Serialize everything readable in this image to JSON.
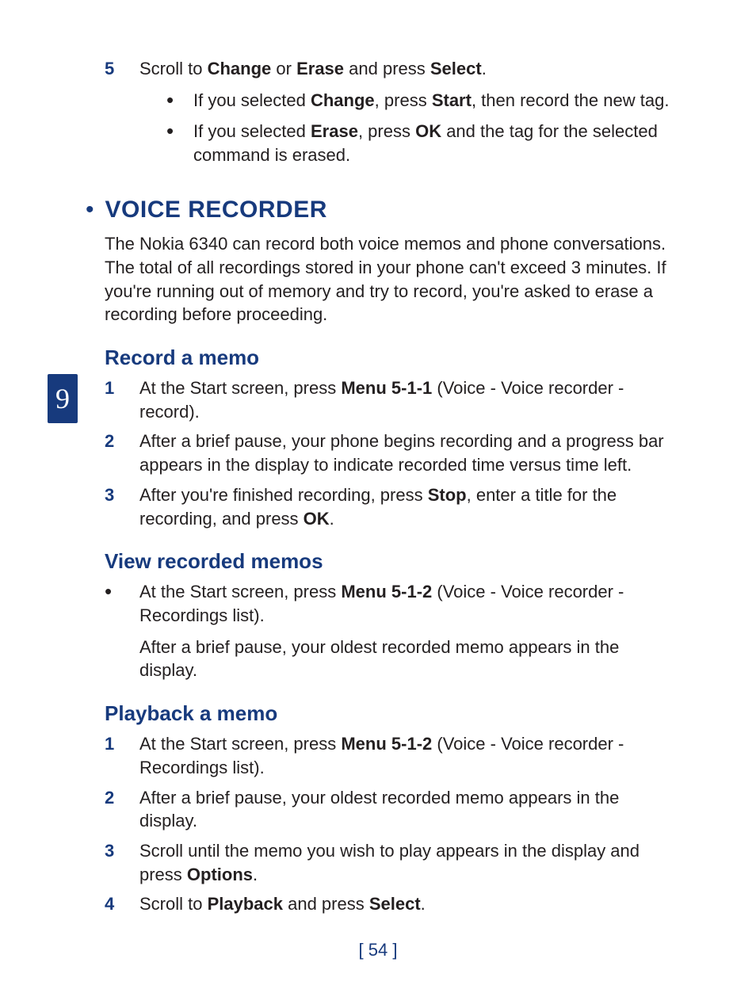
{
  "sideTab": "9",
  "top": {
    "num": "5",
    "text": "Scroll to <b>Change</b> or <b>Erase</b> and press <b>Select</b>.",
    "sub1": "If you selected <b>Change</b>, press <b>Start</b>, then record the new tag.",
    "sub2": "If you selected <b>Erase</b>, press <b>OK</b> and the tag for the selected command is erased."
  },
  "section": {
    "title": "VOICE RECORDER",
    "intro": "The Nokia 6340 can record both voice memos and phone conversations. The total of all recordings stored in your phone can't exceed 3 minutes. If you're running out of memory and try to record, you're asked to erase a recording before proceeding."
  },
  "record": {
    "heading": "Record a memo",
    "i1n": "1",
    "i1": "At the Start screen, press <b>Menu 5-1-1</b> (Voice - Voice recorder - record).",
    "i2n": "2",
    "i2": "After a brief pause, your phone begins recording and a progress bar appears in the display to indicate recorded time versus time left.",
    "i3n": "3",
    "i3": "After you're finished recording, press <b>Stop</b>, enter a title for the recording, and press <b>OK</b>."
  },
  "view": {
    "heading": "View recorded memos",
    "b1": "At the Start screen, press <b>Menu 5-1-2</b> (Voice - Voice recorder - Recordings list).",
    "p1": "After a brief pause, your oldest recorded memo appears in the display."
  },
  "playback": {
    "heading": "Playback a memo",
    "i1n": "1",
    "i1": "At the Start screen, press <b>Menu 5-1-2</b> (Voice - Voice recorder - Recordings list).",
    "i2n": "2",
    "i2": "After a brief pause, your oldest recorded memo appears in the display.",
    "i3n": "3",
    "i3": "Scroll until the memo you wish to play appears in the display and press <b>Options</b>.",
    "i4n": "4",
    "i4": "Scroll to <b>Playback</b> and press <b>Select</b>."
  },
  "pageNumber": "[ 54 ]"
}
